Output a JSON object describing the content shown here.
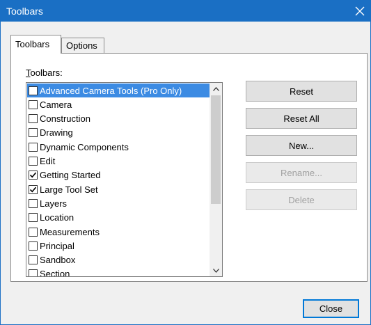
{
  "window": {
    "title": "Toolbars"
  },
  "tabs": [
    {
      "label": "Toolbars",
      "active": true
    },
    {
      "label": "Options",
      "active": false
    }
  ],
  "list": {
    "label_accel": "T",
    "label_rest": "oolbars:",
    "items": [
      {
        "label": "Advanced Camera Tools (Pro Only)",
        "checked": false,
        "selected": true
      },
      {
        "label": "Camera",
        "checked": false,
        "selected": false
      },
      {
        "label": "Construction",
        "checked": false,
        "selected": false
      },
      {
        "label": "Drawing",
        "checked": false,
        "selected": false
      },
      {
        "label": "Dynamic Components",
        "checked": false,
        "selected": false
      },
      {
        "label": "Edit",
        "checked": false,
        "selected": false
      },
      {
        "label": "Getting Started",
        "checked": true,
        "selected": false
      },
      {
        "label": "Large Tool Set",
        "checked": true,
        "selected": false
      },
      {
        "label": "Layers",
        "checked": false,
        "selected": false
      },
      {
        "label": "Location",
        "checked": false,
        "selected": false
      },
      {
        "label": "Measurements",
        "checked": false,
        "selected": false
      },
      {
        "label": "Principal",
        "checked": false,
        "selected": false
      },
      {
        "label": "Sandbox",
        "checked": false,
        "selected": false
      },
      {
        "label": "Section",
        "checked": false,
        "selected": false
      }
    ]
  },
  "buttons": {
    "reset": "Reset",
    "reset_all": "Reset All",
    "new": "New...",
    "rename": "Rename...",
    "delete": "Delete",
    "close": "Close"
  },
  "colors": {
    "titlebar": "#1a6fc4",
    "selection": "#3c8be3"
  }
}
